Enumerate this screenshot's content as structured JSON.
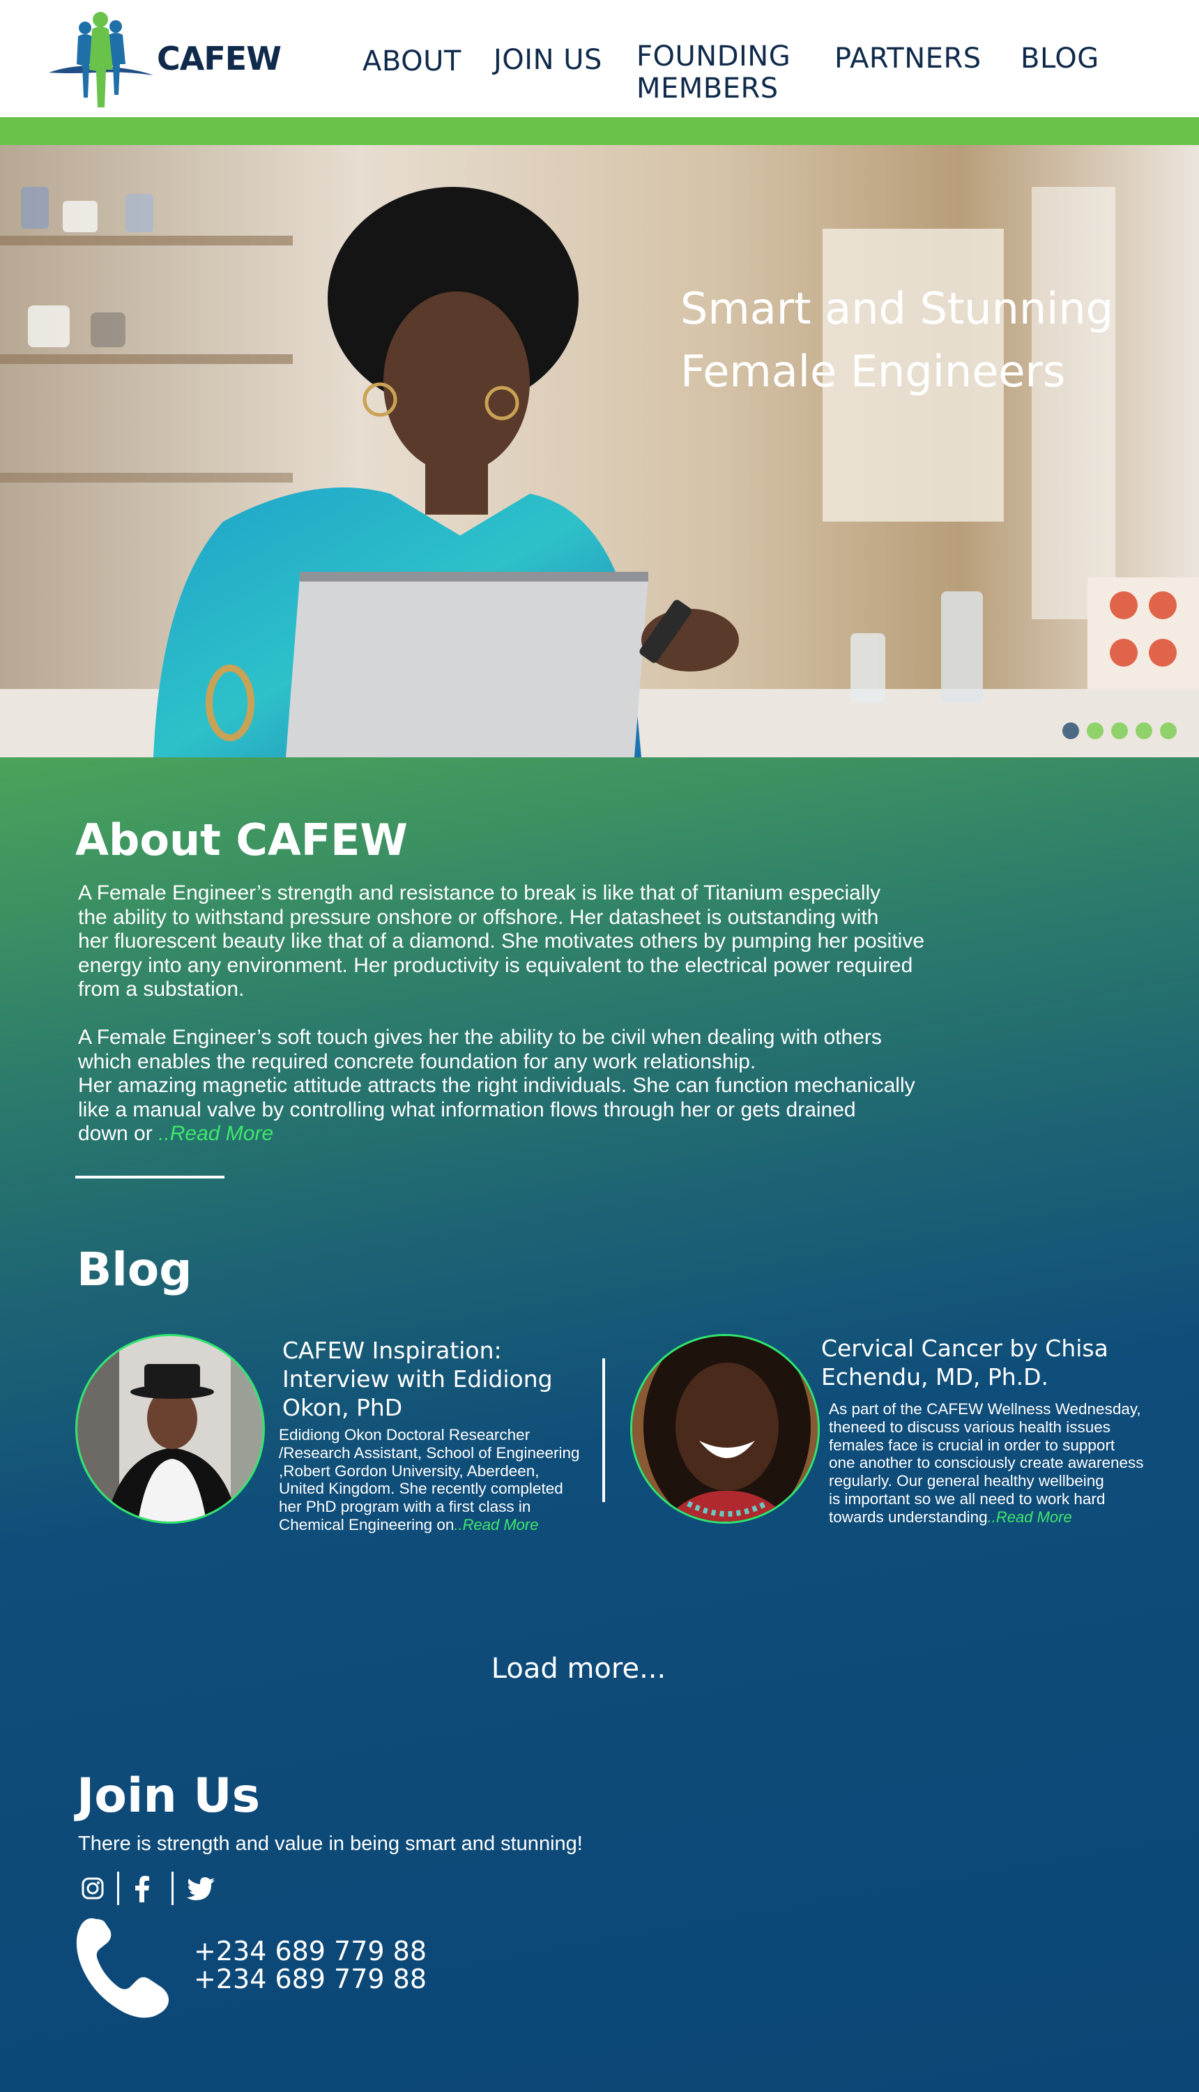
{
  "header": {
    "logo_text": "CAFEW",
    "nav": {
      "about": "ABOUT",
      "join_us": "JOIN US",
      "founding_members_line1": "FOUNDING",
      "founding_members_line2": "MEMBERS",
      "partners": "PARTNERS",
      "blog": "BLOG"
    }
  },
  "hero": {
    "title_line1": "Smart and Stunning",
    "title_line2": "Female Engineers",
    "slide_count": 5,
    "active_slide": 1
  },
  "about": {
    "title": "About CAFEW",
    "paragraph1": "A Female Engineer’s strength and resistance to break is like that of Titanium especially\nthe ability to withstand pressure onshore or offshore. Her datasheet is outstanding with\nher fluorescent beauty like that of a diamond. She motivates others by pumping her positive\n energy into any environment. Her productivity is equivalent to the electrical power required\nfrom a substation.",
    "paragraph2": "A Female Engineer’s soft touch gives her the ability to be civil when dealing with others\nwhich enables the required concrete foundation for any work relationship.\nHer amazing magnetic attitude attracts the right individuals. She can function mechanically\n like a manual valve by controlling what information flows through her or gets drained\ndown or ",
    "read_more": "..Read More"
  },
  "blog": {
    "title": "Blog",
    "posts": [
      {
        "title": "CAFEW Inspiration:\nInterview with Edidiong\nOkon, PhD",
        "excerpt": "Edidiong Okon Doctoral Researcher\n/Research Assistant, School of Engineering\n,Robert Gordon University, Aberdeen,\n United Kingdom. She recently completed\nher PhD program with a first class in\n Chemical Engineering on",
        "read_more": "..Read More"
      },
      {
        "title": "Cervical Cancer by Chisa\n Echendu, MD, Ph.D.",
        "excerpt": "As part of the CAFEW Wellness Wednesday,\n theneed to discuss various health issues\n females face is crucial in order to support\n one another to consciously create awareness\n regularly. Our general healthy wellbeing\nis important so we all need to work hard\ntowards understanding",
        "read_more": "..Read More"
      }
    ],
    "load_more": "Load more..."
  },
  "join": {
    "title": "Join Us",
    "subtitle": "There is strength and value in being smart and stunning!",
    "social_icons": [
      "instagram-icon",
      "facebook-icon",
      "twitter-icon"
    ],
    "phones": [
      "+234 689 779 88",
      "+234 689 779 88"
    ]
  },
  "colors": {
    "accent_green": "#69c34b",
    "link_green": "#3ee86b",
    "navy": "#0f2a4a",
    "footer_blue": "#0b4676"
  }
}
